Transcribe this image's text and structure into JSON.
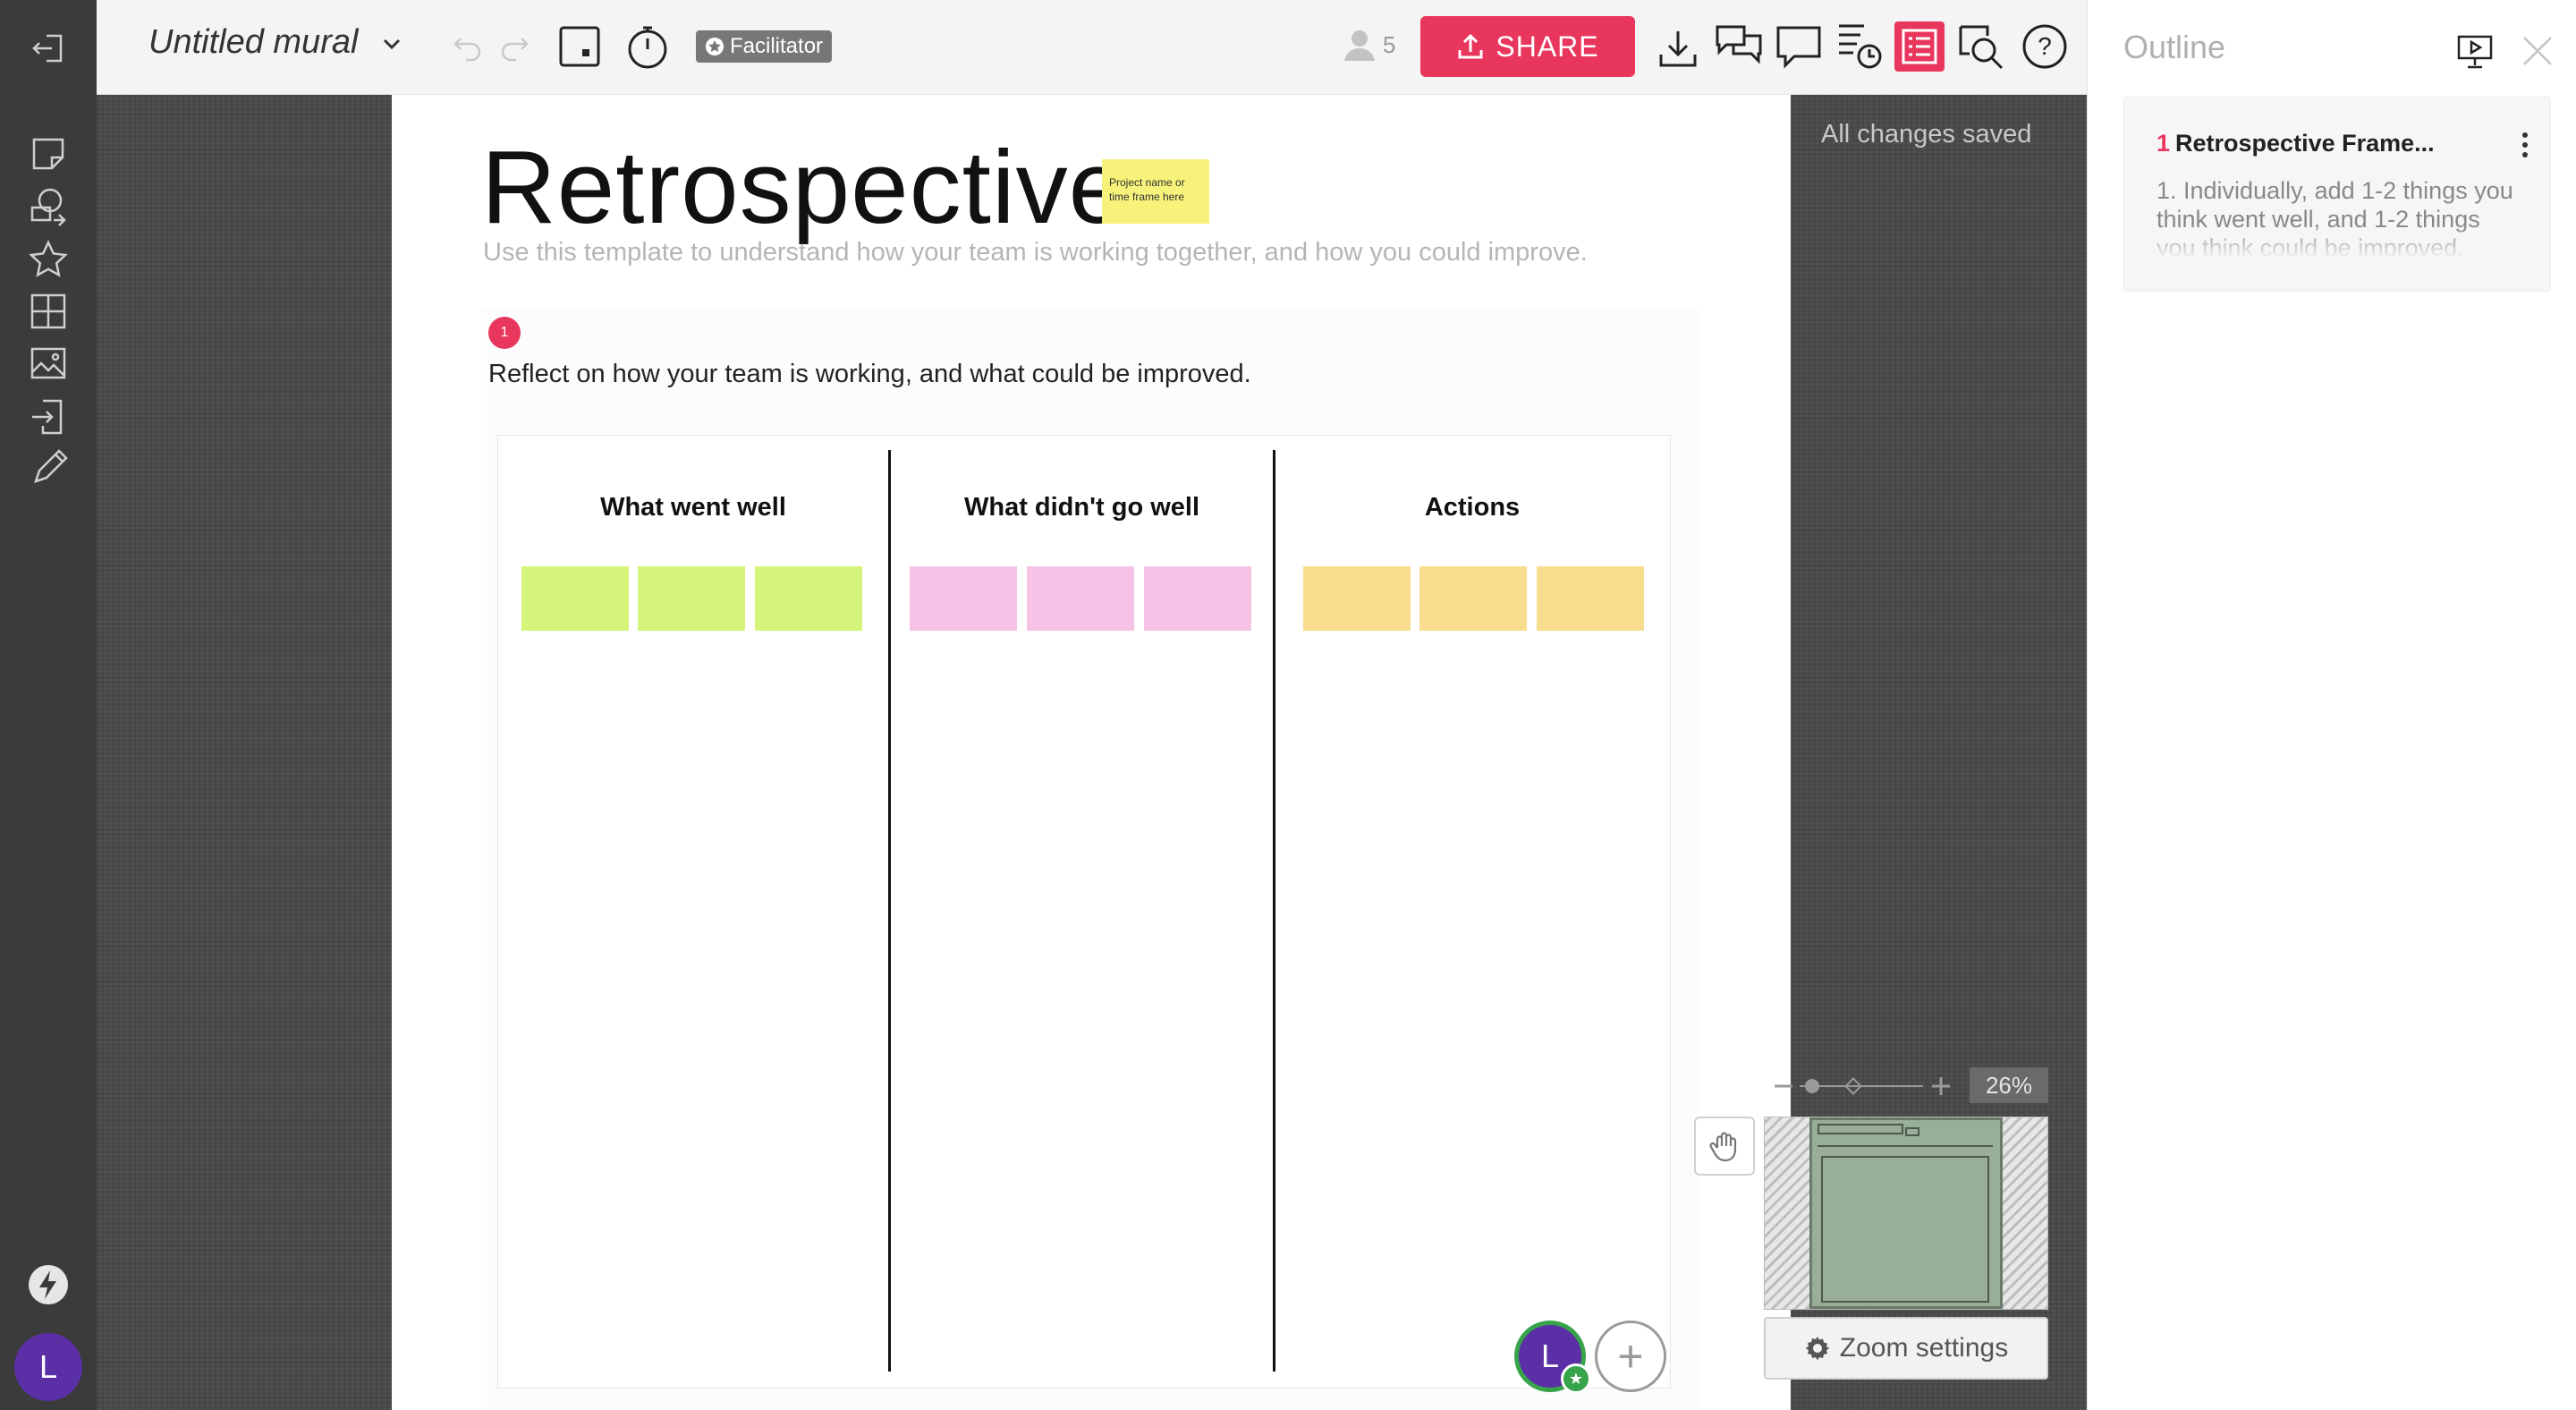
{
  "colors": {
    "accent": "#e8365d",
    "sticky_green": "#d4f47a",
    "sticky_pink": "#f6c3e6",
    "sticky_yellow": "#f8dd8e",
    "title_note": "#f6f27a",
    "avatar_bg": "#5b2fa5",
    "avatar_ring": "#37a34a"
  },
  "left_toolbar": {
    "items": [
      {
        "icon": "exit-icon"
      },
      {
        "icon": "sticky-note-icon"
      },
      {
        "icon": "shapes-icon"
      },
      {
        "icon": "star-icon"
      },
      {
        "icon": "grid-icon"
      },
      {
        "icon": "image-icon"
      },
      {
        "icon": "import-icon"
      },
      {
        "icon": "pencil-icon"
      }
    ],
    "bottom": {
      "lightning_icon": "lightning-icon",
      "avatar_initial": "L"
    }
  },
  "top_bar": {
    "mural_title": "Untitled mural",
    "facilitator_label": "Facilitator",
    "user_count": "5",
    "share_label": "SHARE",
    "icons": [
      "undo-icon",
      "redo-icon",
      "outline-frame-icon",
      "timer-icon",
      "download-icon",
      "chat-icon",
      "comment-icon",
      "activity-icon",
      "outline-list-icon",
      "search-icon",
      "help-icon"
    ]
  },
  "board": {
    "title": "Retrospective",
    "title_note": "Project name or time frame here",
    "subtitle": "Use this template to understand how your team is working together, and how you could improve.",
    "step_number": "1",
    "step_text": "Reflect on how your team is working, and what could be improved.",
    "columns": [
      {
        "heading": "What went well",
        "sticky_color": "#d4f47a",
        "sticky_count": 3
      },
      {
        "heading": "What didn't go well",
        "sticky_color": "#f6c3e6",
        "sticky_count": 3
      },
      {
        "heading": "Actions",
        "sticky_color": "#f8dd8e",
        "sticky_count": 3
      }
    ],
    "avatar_initial": "L"
  },
  "status": {
    "save_status": "All changes saved"
  },
  "zoom": {
    "percent": "26%",
    "settings_label": "Zoom settings"
  },
  "outline": {
    "title": "Outline",
    "card": {
      "number": "1",
      "title": "Retrospective Frame...",
      "description": "1. Individually, add 1-2 things you think went well, and 1-2 things you think could be improved."
    }
  }
}
